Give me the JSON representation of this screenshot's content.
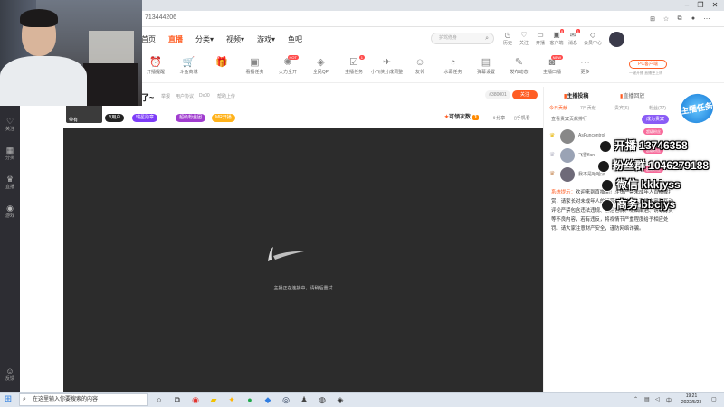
{
  "browser": {
    "address": "713444206",
    "window_controls": [
      "–",
      "❐",
      "✕"
    ]
  },
  "nav": {
    "links": [
      "首页",
      "直播",
      "分类",
      "视频",
      "游戏",
      "鱼吧"
    ],
    "search_placeholder": "护驾修身",
    "header_icons": [
      {
        "label": "历史",
        "icon": "clock-icon"
      },
      {
        "label": "关注",
        "icon": "heart-icon"
      },
      {
        "label": "开播",
        "icon": "video-icon"
      },
      {
        "label": "客户端",
        "icon": "monitor-icon",
        "badge": "8"
      },
      {
        "label": "消息",
        "icon": "mail-icon",
        "badge": "1"
      },
      {
        "label": "会员中心",
        "icon": "diamond-icon"
      }
    ]
  },
  "toolbar": {
    "items": [
      {
        "label": "开播提醒",
        "icon": "alarm-icon"
      },
      {
        "label": "斗鱼商城",
        "icon": "cart-icon"
      },
      {
        "label": "",
        "icon": "gift-icon"
      },
      {
        "label": "看播任务",
        "icon": "ad-icon"
      },
      {
        "label": "火力全开",
        "icon": "fire-icon",
        "badge": "HOT"
      },
      {
        "label": "全民QP",
        "icon": "game-icon"
      },
      {
        "label": "主播任务",
        "icon": "task-icon",
        "badge": "1"
      },
      {
        "label": "小飞侠分成调整",
        "icon": "plane-icon"
      },
      {
        "label": "友邻",
        "icon": "people-icon"
      },
      {
        "label": "水幕任务",
        "icon": "gauge-icon"
      },
      {
        "label": "弹幕设置",
        "icon": "chat-icon"
      },
      {
        "label": "发布动态",
        "icon": "edit-icon"
      },
      {
        "label": "主播口播",
        "icon": "mic-icon",
        "badge": "NEW"
      },
      {
        "label": "更多",
        "icon": "more-icon"
      }
    ],
    "pc_client_label": "PC客户端",
    "pc_client_sub": "一键开播 直播更上线"
  },
  "room": {
    "title": "了~",
    "meta": [
      "举报",
      "用户协议",
      "Dx00",
      "帮助上传"
    ],
    "host_name": "带有",
    "tags": [
      {
        "label": "V用户",
        "color": "#222222"
      },
      {
        "label": "瑞星勋章",
        "color": "#7d3cf8"
      },
      {
        "label": "超级粉丝团",
        "color": "#a03ccf"
      },
      {
        "label": "MR开播",
        "color": "#ffb21a"
      }
    ],
    "room_id": "#380001",
    "follow_label": "关注",
    "gift_label": "可领次数",
    "gift_count": "1",
    "share_label": "分享",
    "record_label": "手机看"
  },
  "video": {
    "loading_text": "主播正在连接中，请稍后重试"
  },
  "right_panel": {
    "tabs": [
      "主播投稿",
      "直播回放"
    ],
    "rank_tabs": [
      "今日贡献",
      "7日贡献",
      "贵宾(6)",
      "粉丝(27)"
    ],
    "noble_tip": "查看贵宾贡献排行",
    "open_noble_label": "成为贵宾",
    "ranks": [
      {
        "name": "AsFuncontrol",
        "badge": "超级粉丝"
      },
      {
        "name": "飞雪flan",
        "badge": "超级粉丝"
      },
      {
        "name": "我不是哈哈派",
        "badge": "超级粉丝"
      }
    ],
    "system_label": "系统提示：",
    "system_text": "欢迎来到直播间！斗鱼严禁未成年人直播或打赏，请家长对未成年人的打赏进行监护。直播内容和互动评论严禁包含违法违规、低俗色情、吸烟酗酒、诱导打赏等不良内容，若有违反，将视情节严重程度给予相应处罚。请大家注意财产安全，谨防网络诈骗。"
  },
  "promo_badge": "主播任务",
  "overlay": [
    {
      "text": "开播 13746358",
      "icon": "qq-icon"
    },
    {
      "text": "粉丝群 1046279188",
      "icon": "qq-group-icon"
    },
    {
      "text": "微信 kkkjyss",
      "icon": "wechat-icon"
    },
    {
      "text": "商务 bbcjys",
      "icon": "business-icon"
    }
  ],
  "rail": [
    "关注",
    "分类",
    "直播",
    "游戏",
    "反馈"
  ],
  "taskbar": {
    "search_placeholder": "在这里输入你要搜索的内容",
    "time": "19:21",
    "date": "2022/5/23"
  }
}
